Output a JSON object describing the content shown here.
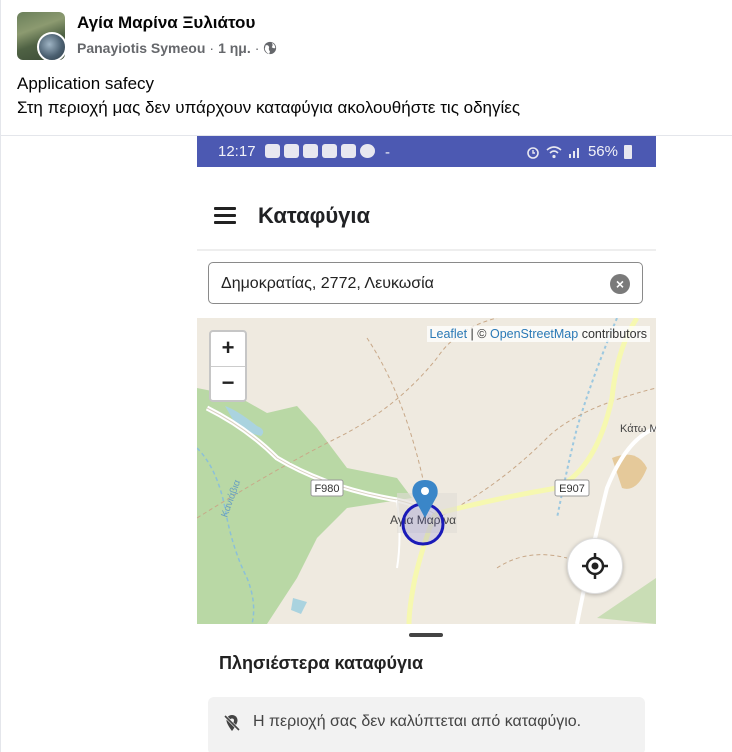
{
  "post": {
    "page_name": "Αγία Μαρίνα Ξυλιάτου",
    "author": "Panayiotis Symeou",
    "time": "1 ημ.",
    "separator": "·",
    "text_line1": "Application safecy",
    "text_line2": "Στη περιοχή μας δεν υπάρχουν καταφύγια ακολουθήστε τις οδηγίες"
  },
  "phone": {
    "status": {
      "time": "12:17",
      "extra": "-",
      "battery": "56%"
    },
    "app_title": "Καταφύγια",
    "search": {
      "value": "Δημοκρατίας, 2772, Λευκωσία",
      "clear_icon": "×"
    },
    "map": {
      "zoom_in": "+",
      "zoom_out": "−",
      "attribution_leaflet": "Leaflet",
      "attribution_sep": " | © ",
      "attribution_osm": "OpenStreetMap",
      "attribution_tail": " contributors",
      "labels": {
        "road1": "F980",
        "road2": "E907",
        "village": "Αγία Μαρίνα",
        "river": "Κανιάβια",
        "east": "Κάτω Μ"
      }
    },
    "sheet": {
      "title": "Πλησιέστερα καταφύγια",
      "notice": "Η περιοχή σας δεν καλύπτεται από καταφύγιο."
    }
  },
  "colors": {
    "statusbar": "#4c59b2",
    "marker": "#3a86c8",
    "circle": "#1a1ab8",
    "forest": "#b9d8a5"
  }
}
